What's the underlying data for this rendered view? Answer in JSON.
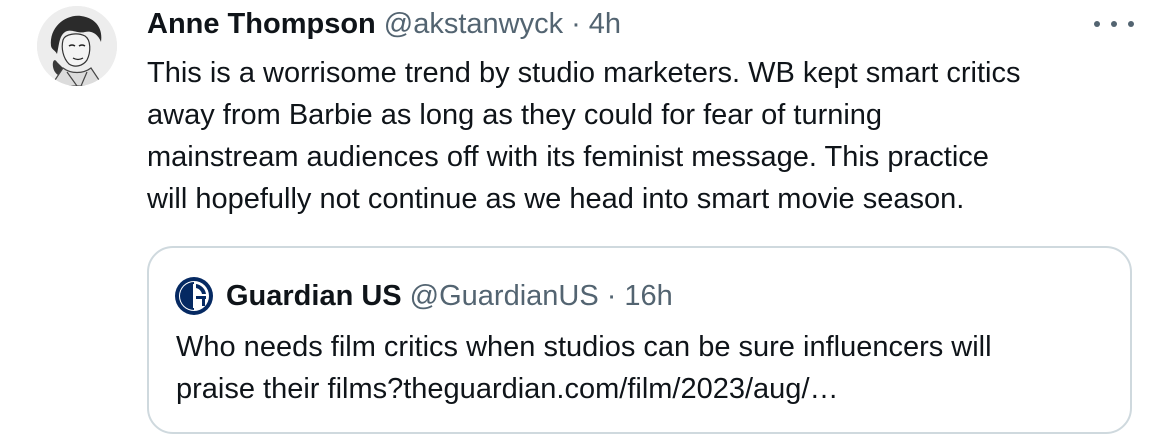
{
  "tweet": {
    "author_name": "Anne Thompson",
    "author_handle": "@akstanwyck",
    "separator": "·",
    "time": "4h",
    "avatar_icon": "profile-photo",
    "more_icon": "ellipsis-icon",
    "text_lines": [
      "This is a worrisome trend by studio marketers. WB kept smart critics",
      "away from Barbie as long as they could for fear of turning",
      "mainstream audiences off with its feminist message. This practice",
      "will hopefully not continue as we head into smart movie season."
    ]
  },
  "quote": {
    "logo_icon": "guardian-logo-icon",
    "author_name": "Guardian US",
    "author_handle": "@GuardianUS",
    "separator": "·",
    "time": "16h",
    "text_lines": [
      "Who needs film critics when studios can be sure influencers will",
      "praise their films?theguardian.com/film/2023/aug/…"
    ]
  },
  "colors": {
    "text": "#0f1419",
    "secondary": "#536471",
    "border": "#cfd9de",
    "guardian_navy": "#052962"
  }
}
